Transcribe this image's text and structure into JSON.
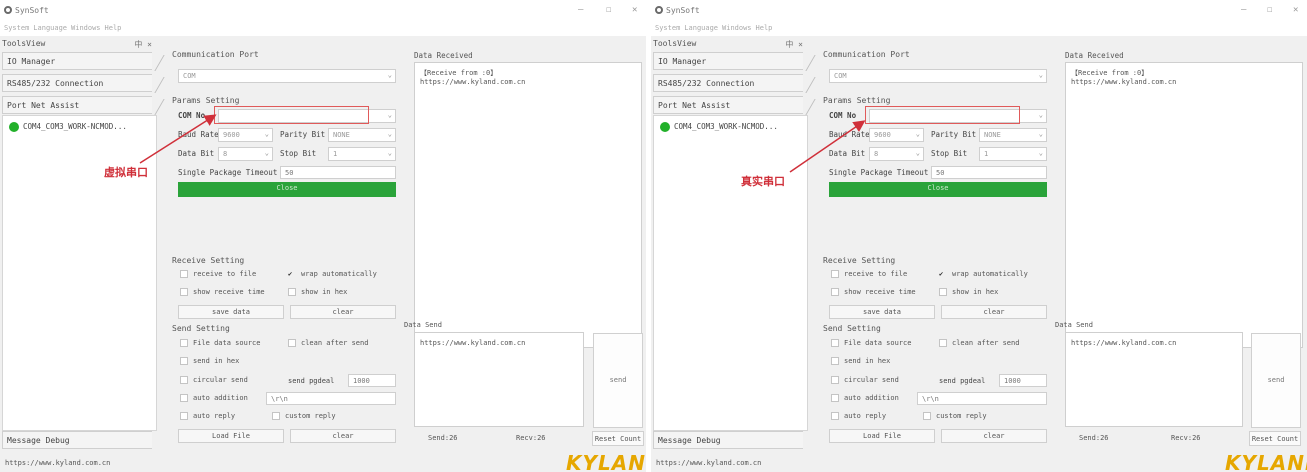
{
  "app": {
    "title": "SynSoft",
    "menu": [
      "System",
      "Language",
      "Windows",
      "Help"
    ],
    "window_controls": [
      "—",
      "☐",
      "✕"
    ]
  },
  "sidebar": {
    "toolbar_title": "ToolsView",
    "pin": "中 ×",
    "items": [
      "IO Manager",
      "RS485/232 Connection",
      "Port Net Assist"
    ],
    "device": "COM4_COM3_WORK-NCMOD...",
    "message_debug": "Message Debug"
  },
  "panel": {
    "comm_port": "Communication Port",
    "port_value": "COM",
    "param_setting": "Params Setting",
    "com_no_label": "COM No",
    "baud_label": "Baud Rate",
    "baud_value": "9600",
    "parity_label": "Parity Bit",
    "parity_value": "NONE",
    "data_bit_label": "Data Bit",
    "data_bit_value": "8",
    "stop_bit_label": "Stop Bit",
    "stop_bit_value": "1",
    "single_pkg_label": "Single Package Timeout",
    "single_pkg_value": "50",
    "open_label": "Close",
    "receive_setting": "Receive Setting",
    "receive_to_file": "receive to file",
    "wrap_auto": "wrap automatically",
    "show_time": "show receive time",
    "show_hex": "show in hex",
    "save_data": "save data",
    "clear": "clear",
    "send_setting": "Send Setting",
    "file_source": "File data source",
    "clean_after": "clean after send",
    "send_hex": "send in hex",
    "circular_send": "circular send",
    "send_period": "send pgdeal",
    "send_period_value": "1000",
    "auto_addition": "auto addition",
    "auto_addition_value": "\\r\\n",
    "auto_reply": "auto reply",
    "custom_reply": "custom reply",
    "load_file": "Load File",
    "clear2": "clear"
  },
  "rx": {
    "heading": "Data Received",
    "line1": "【Receive from :0】",
    "line2": "https://www.kyland.com.cn",
    "send_heading": "Data Send",
    "send_text": "https://www.kyland.com.cn",
    "send_button": "send",
    "send_count": "Send:26",
    "recv_count": "Recv:26",
    "reset": "Reset Count"
  },
  "status": {
    "url": "https://www.kyland.com.cn"
  },
  "brand": "KYLAND",
  "annotations": {
    "virtual": "虚拟串口",
    "real": "真实串口"
  },
  "colors": {
    "open_button": "#2aa33a",
    "device_dot": "#22b02a",
    "annotation": "#d0303a",
    "brand": "#e6a700"
  }
}
